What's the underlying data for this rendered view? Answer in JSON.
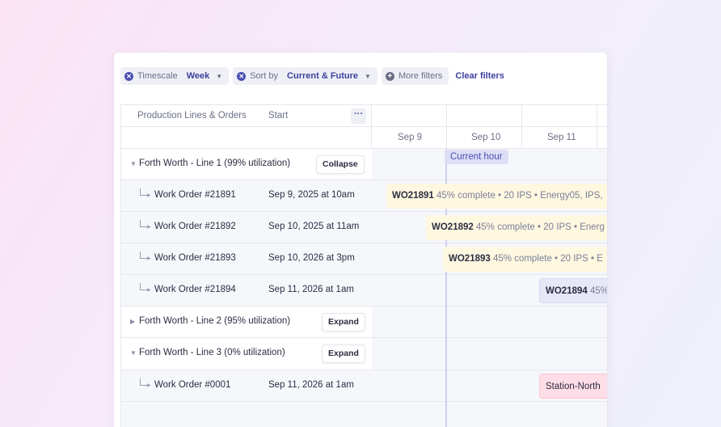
{
  "filters": {
    "timescale": {
      "label": "Timescale",
      "value": "Week"
    },
    "sort": {
      "label": "Sort by",
      "value": "Current & Future"
    },
    "more": {
      "label": "More filters"
    },
    "clear": "Clear filters"
  },
  "table": {
    "col_name": "Production Lines & Orders",
    "col_start": "Start",
    "more_icon": "···"
  },
  "timeline": {
    "dates": [
      "Sep 9",
      "Sep 10",
      "Sep 11"
    ],
    "current_hour": "Current hour"
  },
  "groups": [
    {
      "name": "Forth Worth - Line 1 (99% utilization)",
      "button": "Collapse",
      "expanded": true
    },
    {
      "name": "Forth Worth - Line 2 (95% utilization)",
      "button": "Expand",
      "expanded": false
    },
    {
      "name": "Forth Worth - Line 3 (0% utilization)",
      "button": "Expand",
      "expanded": true
    }
  ],
  "orders": [
    {
      "name": "Work Order #21891",
      "start": "Sep 9, 2025 at 10am",
      "bar_id": "WO21891",
      "bar_meta": "45% complete  •  20 IPS  •  Energy05, IPS,"
    },
    {
      "name": "Work Order #21892",
      "start": "Sep 10, 2025 at 11am",
      "bar_id": "WO21892",
      "bar_meta": "45% complete  •  20 IPS  •  Energ"
    },
    {
      "name": "Work Order #21893",
      "start": "Sep 10, 2026 at 3pm",
      "bar_id": "WO21893",
      "bar_meta": "45% complete  •  20 IPS  •  E"
    },
    {
      "name": "Work Order #21894",
      "start": "Sep 11, 2026 at 1am",
      "bar_id": "WO21894",
      "bar_meta": "45%"
    },
    {
      "name": "Work Order #0001",
      "start": "Sep 11, 2026 at 1am",
      "bar_id": "Station-North",
      "bar_meta": ""
    }
  ],
  "colors": {
    "accent": "#3d3f9e",
    "bar_yellow": "#fff8e1",
    "bar_lavender": "#e6e7f7",
    "bar_pink": "#ffdde6",
    "current_hour": "#dedff6"
  }
}
